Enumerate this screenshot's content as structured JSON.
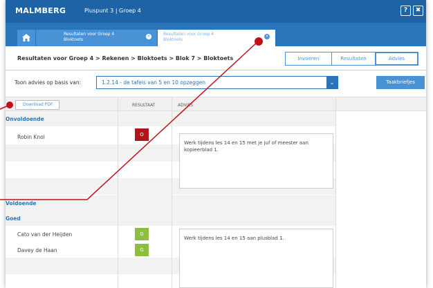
{
  "topbar": {
    "logo": "MALMBERG",
    "course": "Pluspunt 3  |  Groep 4",
    "help_label": "?",
    "close_label": "✖"
  },
  "tabs": [
    {
      "line1": "Resultaten voor Groep 4",
      "line2": "Bloktoets",
      "active": false
    },
    {
      "line1": "Resultaten voor Groep 4",
      "line2": "Bloktoets",
      "active": true
    }
  ],
  "breadcrumb": "Resultaten voor Groep 4 > Rekenen > Bloktoets > Blok 7 > Bloktoets",
  "view_tabs": [
    "Invoeren",
    "Resultaten",
    "Advies"
  ],
  "advies": {
    "label": "Toon advies op basis van:",
    "selected": "1.2.14 - de tafels van 5 en 10 opzeggen",
    "taakbriefjes": "Taakbriefjes"
  },
  "table": {
    "download_pdf": "Download PDF",
    "col_resultaat": "RESULTAAT",
    "col_advies": "ADVIES"
  },
  "groups": [
    {
      "label": "Onvoldoende",
      "students": [
        {
          "name": "Robin Knol",
          "result": "O"
        }
      ],
      "advice": "Werk tijdens les 14 en 15 met je juf of meester aan kopieerblad 1."
    },
    {
      "label": "Voldoende",
      "students": [],
      "advice": ""
    },
    {
      "label": "Goed",
      "students": [
        {
          "name": "Cato van der Heijden",
          "result": "G"
        },
        {
          "name": "Davey de Haan",
          "result": "G"
        }
      ],
      "advice": "Werk tijdens les 14 en 15 aan plusblad 1."
    }
  ],
  "colors": {
    "topbar": "#1e63a6",
    "accent": "#4a92d6",
    "onvoldoende": "#b3141c",
    "goed": "#8cbf3f",
    "annotation": "#c0101c"
  },
  "icons": {
    "home": "home-icon",
    "tab_close": "close-icon",
    "dropdown": "chevron-down-icon"
  }
}
